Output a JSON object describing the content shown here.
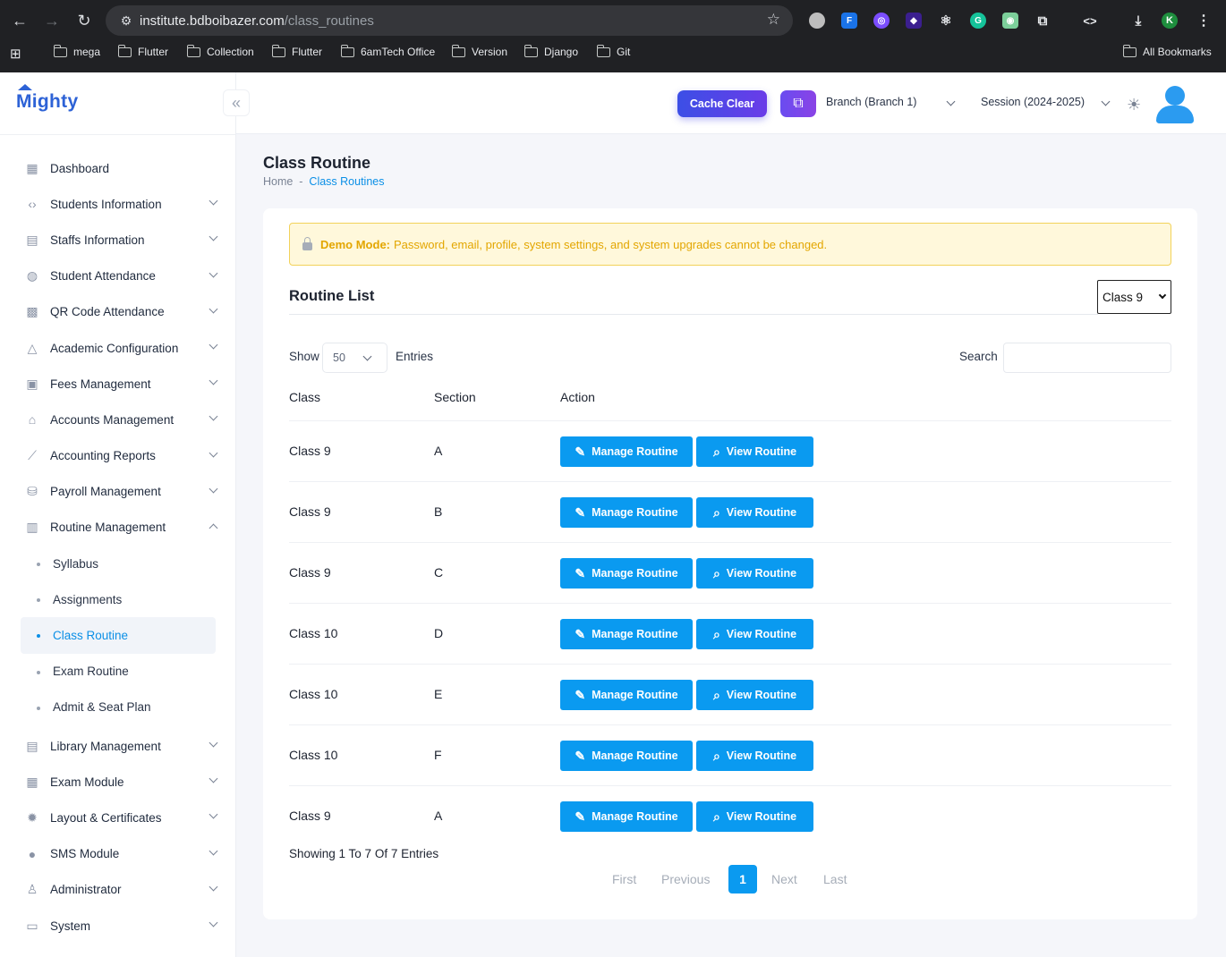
{
  "browser": {
    "url_host": "institute.bdboibazer.com",
    "url_path": "/class_routines",
    "profile_initial": "K",
    "bookmarks": [
      "mega",
      "Flutter",
      "Collection",
      "Flutter",
      "6amTech Office",
      "Version",
      "Django",
      "Git"
    ],
    "all_bookmarks": "All Bookmarks"
  },
  "sidebar": {
    "logo": "Mighty",
    "items": [
      {
        "label": "Dashboard",
        "icon": "grid-icon"
      },
      {
        "label": "Students Information",
        "icon": "code-icon"
      },
      {
        "label": "Staffs Information",
        "icon": "id-card-icon"
      },
      {
        "label": "Student Attendance",
        "icon": "fingerprint-icon"
      },
      {
        "label": "QR Code Attendance",
        "icon": "qr-code-icon"
      },
      {
        "label": "Academic Configuration",
        "icon": "drive-icon"
      },
      {
        "label": "Fees Management",
        "icon": "money-icon"
      },
      {
        "label": "Accounts Management",
        "icon": "bank-icon"
      },
      {
        "label": "Accounting Reports",
        "icon": "chart-line-icon"
      },
      {
        "label": "Payroll Management",
        "icon": "payroll-icon"
      },
      {
        "label": "Routine Management",
        "icon": "map-icon"
      }
    ],
    "routine_sub": [
      "Syllabus",
      "Assignments",
      "Class Routine",
      "Exam Routine",
      "Admit & Seat Plan"
    ],
    "items_after": [
      {
        "label": "Library Management",
        "icon": "book-icon"
      },
      {
        "label": "Exam Module",
        "icon": "layout-icon"
      },
      {
        "label": "Layout & Certificates",
        "icon": "badge-icon"
      },
      {
        "label": "SMS Module",
        "icon": "sms-icon"
      },
      {
        "label": "Administrator",
        "icon": "user-gear-icon"
      },
      {
        "label": "System",
        "icon": "server-icon"
      }
    ]
  },
  "header": {
    "cache_clear": "Cache Clear",
    "branch": "Branch (Branch 1)",
    "session": "Session (2024-2025)"
  },
  "page": {
    "title": "Class Routine",
    "breadcrumb_home": "Home",
    "breadcrumb_sep": "-",
    "breadcrumb_current": "Class Routines"
  },
  "alert": {
    "label": "Demo Mode:",
    "message": "Password, email, profile, system settings, and system upgrades cannot be changed."
  },
  "routine": {
    "title": "Routine List",
    "class_filter": "Class 9",
    "show_label": "Show",
    "entries_value": "50",
    "entries_label": "Entries",
    "search_label": "Search",
    "search_placeholder": "",
    "columns": [
      "Class",
      "Section",
      "Action"
    ],
    "manage_label": "Manage Routine",
    "view_label": "View Routine",
    "rows": [
      {
        "class": "Class 9",
        "section": "A"
      },
      {
        "class": "Class 9",
        "section": "B"
      },
      {
        "class": "Class 9",
        "section": "C"
      },
      {
        "class": "Class 10",
        "section": "D"
      },
      {
        "class": "Class 10",
        "section": "E"
      },
      {
        "class": "Class 10",
        "section": "F"
      },
      {
        "class": "Class 9",
        "section": "A"
      }
    ],
    "showing": "Showing 1 To 7 Of 7 Entries",
    "pagination": {
      "first": "First",
      "previous": "Previous",
      "current": "1",
      "next": "Next",
      "last": "Last"
    }
  },
  "colors": {
    "accent": "#0a9af0",
    "cache_gradient": "#3c4fe6",
    "warning": "#e3a600"
  }
}
